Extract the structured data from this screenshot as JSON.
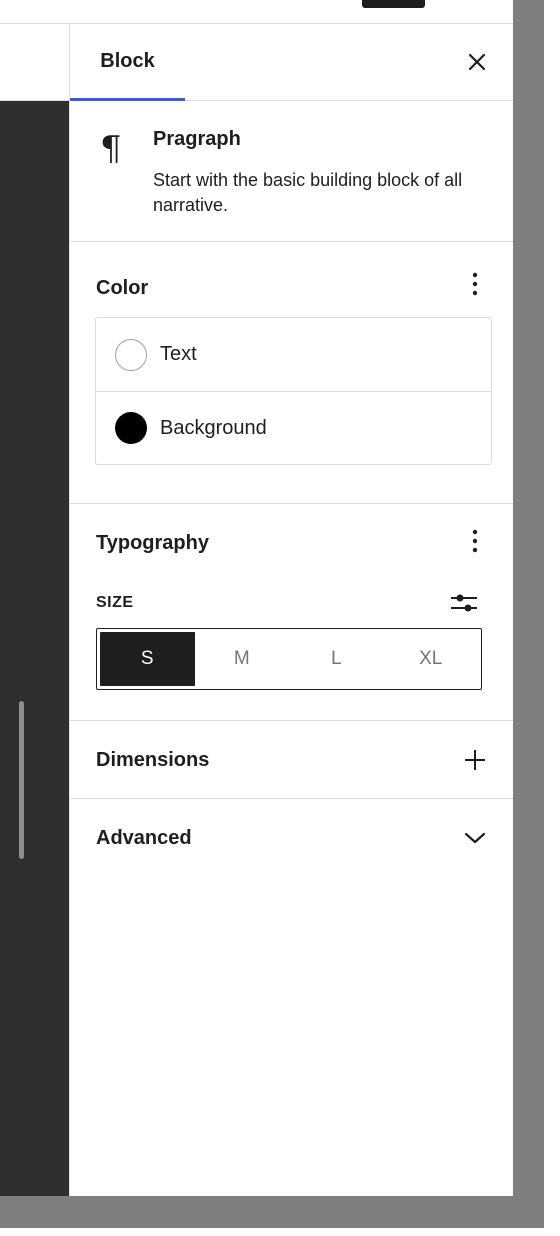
{
  "panel": {
    "tab_label": "Block",
    "close_icon": "close-icon"
  },
  "block_card": {
    "icon": "paragraph-icon",
    "title": "Pragraph",
    "description": "Start with the basic building block of all narrative."
  },
  "color": {
    "title": "Color",
    "items": [
      {
        "label": "Text",
        "swatch": "#ffffff"
      },
      {
        "label": "Background",
        "swatch": "#000000"
      }
    ]
  },
  "typography": {
    "title": "Typography",
    "size_label": "SIZE",
    "sizes": [
      "S",
      "M",
      "L",
      "XL"
    ],
    "selected_size": "S"
  },
  "dimensions": {
    "title": "Dimensions"
  },
  "advanced": {
    "title": "Advanced"
  },
  "colors": {
    "accent": "#3858e9",
    "dark": "#1e1e1e",
    "canvas": "#2f2f2f",
    "overlay": "#7f7f7f"
  }
}
